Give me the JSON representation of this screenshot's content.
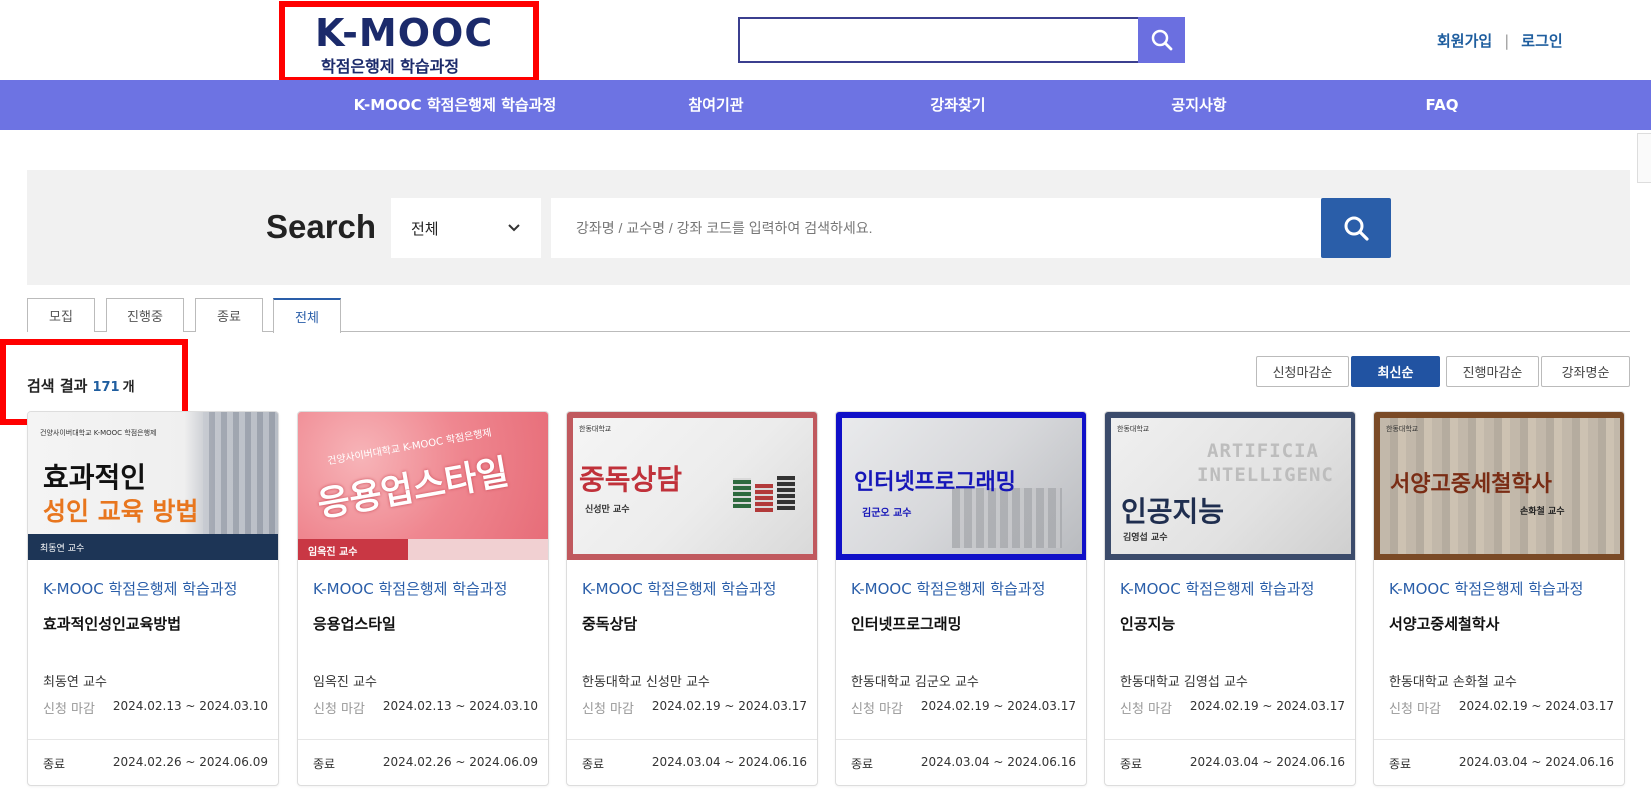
{
  "header": {
    "logo_main": "K-MOOC",
    "logo_sub": "학점은행제 학습과정",
    "member": {
      "signup": "회원가입",
      "separator": "|",
      "login": "로그인"
    },
    "search_icon": "search-icon"
  },
  "nav": {
    "items": [
      {
        "label": "K-MOOC 학점은행제 학습과정"
      },
      {
        "label": "참여기관"
      },
      {
        "label": "강좌찾기"
      },
      {
        "label": "공지사항"
      },
      {
        "label": "FAQ"
      }
    ],
    "color": "#6d73e3"
  },
  "search": {
    "title": "Search",
    "select_value": "전체",
    "placeholder": "강좌명 / 교수명 / 강좌 코드를 입력하여 검색하세요.",
    "button_color": "#2a5ea9"
  },
  "tabs": [
    {
      "label": "모집"
    },
    {
      "label": "진행중"
    },
    {
      "label": "종료"
    },
    {
      "label": "전체"
    }
  ],
  "result": {
    "label": "검색 결과",
    "count": "171",
    "unit": "개"
  },
  "sort": [
    {
      "label": "신청마감순"
    },
    {
      "label": "최신순"
    },
    {
      "label": "진행마감순"
    },
    {
      "label": "강좌명순"
    }
  ],
  "cards": [
    {
      "thumb_header": "건양사이버대학교 K-MOOC 학점은행제",
      "thumb_line1": "효과적인",
      "thumb_line2": "성인 교육 방법",
      "thumb_prof": "최동연 교수",
      "inst": "K-MOOC 학점은행제 학습과정",
      "title": "효과적인성인교육방법",
      "prof": "최동연 교수",
      "apply_label": "신청 마감",
      "apply_dates": "2024.02.13 ~ 2024.03.10",
      "status": "종료",
      "course_dates": "2024.02.26 ~ 2024.06.09"
    },
    {
      "thumb_header": "건양사이버대학교 K-MOOC 학점은행제",
      "thumb_line1": "응용업스타일",
      "thumb_prof": "임옥진 교수",
      "inst": "K-MOOC 학점은행제 학습과정",
      "title": "응용업스타일",
      "prof": "임옥진 교수",
      "apply_label": "신청 마감",
      "apply_dates": "2024.02.13 ~ 2024.03.10",
      "status": "종료",
      "course_dates": "2024.02.26 ~ 2024.06.09"
    },
    {
      "thumb_header": "한동대학교",
      "thumb_line1": "중독상담",
      "thumb_prof": "신성만 교수",
      "inst": "K-MOOC 학점은행제 학습과정",
      "title": "중독상담",
      "prof": "한동대학교 신성만 교수",
      "apply_label": "신청 마감",
      "apply_dates": "2024.02.19 ~ 2024.03.17",
      "status": "종료",
      "course_dates": "2024.03.04 ~ 2024.06.16"
    },
    {
      "thumb_line1": "인터넷프로그래밍",
      "thumb_prof": "김군오 교수",
      "inst": "K-MOOC 학점은행제 학습과정",
      "title": "인터넷프로그래밍",
      "prof": "한동대학교 김군오 교수",
      "apply_label": "신청 마감",
      "apply_dates": "2024.02.19 ~ 2024.03.17",
      "status": "종료",
      "course_dates": "2024.03.04 ~ 2024.06.16"
    },
    {
      "thumb_header": "한동대학교",
      "thumb_bg1": "ARTIFICIA",
      "thumb_bg2": "INTELLIGENC",
      "thumb_line1": "인공지능",
      "thumb_prof": "김영섭 교수",
      "inst": "K-MOOC 학점은행제 학습과정",
      "title": "인공지능",
      "prof": "한동대학교 김영섭 교수",
      "apply_label": "신청 마감",
      "apply_dates": "2024.02.19 ~ 2024.03.17",
      "status": "종료",
      "course_dates": "2024.03.04 ~ 2024.06.16"
    },
    {
      "thumb_header": "한동대학교",
      "thumb_line1": "서양고중세철학사",
      "thumb_prof": "손화철 교수",
      "inst": "K-MOOC 학점은행제 학습과정",
      "title": "서양고중세철학사",
      "prof": "한동대학교 손화철 교수",
      "apply_label": "신청 마감",
      "apply_dates": "2024.02.19 ~ 2024.03.17",
      "status": "종료",
      "course_dates": "2024.03.04 ~ 2024.06.16"
    }
  ]
}
